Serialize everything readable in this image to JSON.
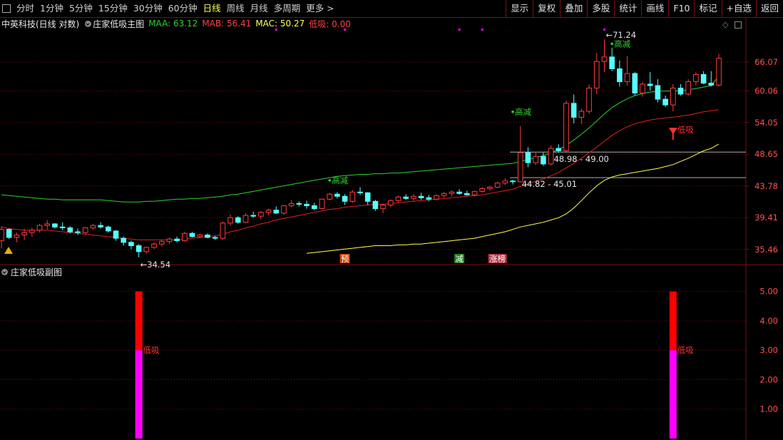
{
  "toolbar": {
    "periods": [
      "分时",
      "1分钟",
      "5分钟",
      "15分钟",
      "30分钟",
      "60分钟",
      "日线",
      "周线",
      "月线",
      "多周期",
      "更多 >"
    ],
    "active": "日线",
    "right_buttons": [
      "显示",
      "复权",
      "叠加",
      "多股",
      "统计",
      "画线",
      "F10",
      "标记",
      "+自选",
      "返回"
    ]
  },
  "info": {
    "stock": "中英科技(日线 对数)",
    "indicator": "庄家低吸主图",
    "maa": "MAA: 63.12",
    "mab": "MAB: 56.41",
    "mac": "MAC: 50.27",
    "dixi": "低吸: 0.00"
  },
  "sub": {
    "title": "庄家低吸副图"
  },
  "colors": {
    "up": "#ff3c3c",
    "down": "#54ffff",
    "maa": "#2fd12f",
    "mab": "#e02020",
    "mac": "#ffff55",
    "grid": "#7a1010",
    "axis_text": "#ff5050",
    "magenta": "#ff00ff"
  },
  "chart_data": [
    {
      "type": "candlestick",
      "title": "中英科技(日线 对数)",
      "log_scale": true,
      "ylim": [
        33.8,
        73.5
      ],
      "y_ticks": [
        66.07,
        60.06,
        54.05,
        48.65,
        43.78,
        39.41,
        35.46
      ],
      "y_tick_labels": [
        "66.07",
        "60.06",
        "54.05",
        "48.65",
        "43.78",
        "39.41",
        "35.46"
      ],
      "candles": [
        [
          36.5,
          38.3,
          35.6,
          37.9
        ],
        [
          37.9,
          38.0,
          36.7,
          36.9
        ],
        [
          36.9,
          37.5,
          36.3,
          37.2
        ],
        [
          37.2,
          38.0,
          36.6,
          37.5
        ],
        [
          37.5,
          38.1,
          37.0,
          37.8
        ],
        [
          37.8,
          38.6,
          37.5,
          38.4
        ],
        [
          38.4,
          39.1,
          37.9,
          38.6
        ],
        [
          38.6,
          38.7,
          38.0,
          38.2
        ],
        [
          38.2,
          38.8,
          37.8,
          38.1
        ],
        [
          38.1,
          38.3,
          37.4,
          37.6
        ],
        [
          37.6,
          38.0,
          37.2,
          37.5
        ],
        [
          37.5,
          38.2,
          37.3,
          38.1
        ],
        [
          38.1,
          38.6,
          37.9,
          38.4
        ],
        [
          38.4,
          38.8,
          38.0,
          38.2
        ],
        [
          38.2,
          38.4,
          37.5,
          37.7
        ],
        [
          37.7,
          37.8,
          36.5,
          36.8
        ],
        [
          36.8,
          37.0,
          35.9,
          36.3
        ],
        [
          36.3,
          36.5,
          35.5,
          35.9
        ],
        [
          35.9,
          36.1,
          34.54,
          35.2
        ],
        [
          35.2,
          35.8,
          35.0,
          35.7
        ],
        [
          35.7,
          36.3,
          35.5,
          36.1
        ],
        [
          36.1,
          36.6,
          35.8,
          36.4
        ],
        [
          36.4,
          36.9,
          36.1,
          36.7
        ],
        [
          36.7,
          37.0,
          36.3,
          36.5
        ],
        [
          36.5,
          37.6,
          36.4,
          37.4
        ],
        [
          37.4,
          37.6,
          36.9,
          37.0
        ],
        [
          37.0,
          37.4,
          36.8,
          37.2
        ],
        [
          37.2,
          37.4,
          36.8,
          36.9
        ],
        [
          36.9,
          37.1,
          36.6,
          36.8
        ],
        [
          36.8,
          38.9,
          36.6,
          38.7
        ],
        [
          38.7,
          39.8,
          38.4,
          39.4
        ],
        [
          39.4,
          39.6,
          38.6,
          38.8
        ],
        [
          38.8,
          40.0,
          38.7,
          39.7
        ],
        [
          39.7,
          40.2,
          39.4,
          39.6
        ],
        [
          39.6,
          40.3,
          39.2,
          40.1
        ],
        [
          40.1,
          40.6,
          39.7,
          40.4
        ],
        [
          40.4,
          40.9,
          39.9,
          40.0
        ],
        [
          40.0,
          41.1,
          39.8,
          41.0
        ],
        [
          41.0,
          41.8,
          40.8,
          41.3
        ],
        [
          41.3,
          41.6,
          40.9,
          41.2
        ],
        [
          41.2,
          41.7,
          40.6,
          41.0
        ],
        [
          41.0,
          41.4,
          40.4,
          40.6
        ],
        [
          40.6,
          42.0,
          40.5,
          41.9
        ],
        [
          41.9,
          42.8,
          41.7,
          42.6
        ],
        [
          42.6,
          42.9,
          42.0,
          42.3
        ],
        [
          42.3,
          42.6,
          41.1,
          41.6
        ],
        [
          41.6,
          43.2,
          41.4,
          42.9
        ],
        [
          42.9,
          43.6,
          42.5,
          42.8
        ],
        [
          42.8,
          42.9,
          41.1,
          41.6
        ],
        [
          41.6,
          41.8,
          40.3,
          40.6
        ],
        [
          40.6,
          41.3,
          40.0,
          41.1
        ],
        [
          41.1,
          41.9,
          40.8,
          41.7
        ],
        [
          41.7,
          42.4,
          41.4,
          42.2
        ],
        [
          42.2,
          42.6,
          41.8,
          42.0
        ],
        [
          42.0,
          42.6,
          41.7,
          42.3
        ],
        [
          42.3,
          42.8,
          41.8,
          42.1
        ],
        [
          42.1,
          42.5,
          41.6,
          41.9
        ],
        [
          41.9,
          42.6,
          41.7,
          42.4
        ],
        [
          42.4,
          42.9,
          42.1,
          42.7
        ],
        [
          42.7,
          43.1,
          42.3,
          42.9
        ],
        [
          42.9,
          43.3,
          42.5,
          42.7
        ],
        [
          42.7,
          43.1,
          42.4,
          42.5
        ],
        [
          42.5,
          43.1,
          42.3,
          43.0
        ],
        [
          43.0,
          43.6,
          42.8,
          43.4
        ],
        [
          43.4,
          43.8,
          43.1,
          43.6
        ],
        [
          43.6,
          44.4,
          43.5,
          44.2
        ],
        [
          44.2,
          44.9,
          43.9,
          44.5
        ],
        [
          44.5,
          44.7,
          44.0,
          44.4
        ],
        [
          44.4,
          53.4,
          44.3,
          48.9
        ],
        [
          48.9,
          49.8,
          46.6,
          47.3
        ],
        [
          47.3,
          48.9,
          46.9,
          48.3
        ],
        [
          48.3,
          48.9,
          46.8,
          47.1
        ],
        [
          47.1,
          50.1,
          46.9,
          49.6
        ],
        [
          49.6,
          50.3,
          48.9,
          49.2
        ],
        [
          49.2,
          58.1,
          49.1,
          57.6
        ],
        [
          57.6,
          59.3,
          53.9,
          55.0
        ],
        [
          55.0,
          56.6,
          53.8,
          56.1
        ],
        [
          56.1,
          61.3,
          55.7,
          60.6
        ],
        [
          60.6,
          68.1,
          59.4,
          66.2
        ],
        [
          66.2,
          71.24,
          63.9,
          67.2
        ],
        [
          67.2,
          69.3,
          64.1,
          64.6
        ],
        [
          64.6,
          66.4,
          60.9,
          61.9
        ],
        [
          61.9,
          67.4,
          61.1,
          63.6
        ],
        [
          63.6,
          63.9,
          59.1,
          59.6
        ],
        [
          59.6,
          61.9,
          58.9,
          61.4
        ],
        [
          61.4,
          63.9,
          60.1,
          61.1
        ],
        [
          61.1,
          62.4,
          57.8,
          58.4
        ],
        [
          58.4,
          59.1,
          56.9,
          57.3
        ],
        [
          57.3,
          61.4,
          56.1,
          60.6
        ],
        [
          60.6,
          61.4,
          59.1,
          59.4
        ],
        [
          59.4,
          62.4,
          59.1,
          61.9
        ],
        [
          61.9,
          63.9,
          61.1,
          63.4
        ],
        [
          63.4,
          64.1,
          61.4,
          61.6
        ],
        [
          61.6,
          64.1,
          60.9,
          61.2
        ],
        [
          61.2,
          67.9,
          60.9,
          66.9
        ]
      ],
      "series": [
        {
          "name": "MAA",
          "values": [
            42.5,
            42.4,
            42.3,
            42.2,
            42.1,
            42.0,
            41.9,
            41.9,
            41.8,
            41.8,
            41.8,
            41.8,
            41.8,
            41.8,
            41.7,
            41.6,
            41.5,
            41.5,
            41.5,
            41.6,
            41.6,
            41.7,
            41.8,
            41.9,
            41.9,
            42.0,
            42.0,
            42.1,
            42.2,
            42.3,
            42.5,
            42.6,
            42.8,
            43.0,
            43.2,
            43.4,
            43.6,
            43.8,
            44.0,
            44.2,
            44.4,
            44.6,
            44.8,
            45.0,
            45.2,
            45.3,
            45.4,
            45.5,
            45.5,
            45.6,
            45.6,
            45.7,
            45.7,
            45.8,
            45.9,
            46.0,
            46.1,
            46.2,
            46.3,
            46.4,
            46.5,
            46.6,
            46.7,
            46.8,
            46.9,
            47.0,
            47.1,
            47.2,
            47.5,
            47.8,
            48.1,
            48.4,
            48.9,
            49.4,
            50.1,
            51.0,
            52.0,
            53.1,
            54.3,
            55.6,
            56.8,
            57.7,
            58.5,
            59.1,
            59.5,
            59.8,
            60.0,
            60.0,
            60.0,
            60.1,
            60.3,
            60.5,
            60.8,
            61.1,
            63.1
          ]
        },
        {
          "name": "MAB",
          "values": [
            38.2,
            38.0,
            37.9,
            37.8,
            37.8,
            37.8,
            37.8,
            37.7,
            37.6,
            37.5,
            37.4,
            37.3,
            37.2,
            37.1,
            37.0,
            36.9,
            36.8,
            36.7,
            36.6,
            36.6,
            36.6,
            36.6,
            36.6,
            36.6,
            36.7,
            36.8,
            36.9,
            37.0,
            37.1,
            37.3,
            37.6,
            37.8,
            38.1,
            38.3,
            38.6,
            38.8,
            39.1,
            39.3,
            39.5,
            39.7,
            39.9,
            40.1,
            40.3,
            40.5,
            40.6,
            40.8,
            40.9,
            41.0,
            41.1,
            41.2,
            41.2,
            41.3,
            41.4,
            41.5,
            41.6,
            41.7,
            41.8,
            41.9,
            42.0,
            42.1,
            42.2,
            42.3,
            42.4,
            42.5,
            42.7,
            42.9,
            43.1,
            43.3,
            43.7,
            44.1,
            44.5,
            44.8,
            45.3,
            45.8,
            46.5,
            47.2,
            48.0,
            48.9,
            49.8,
            50.8,
            51.8,
            52.6,
            53.3,
            53.8,
            54.2,
            54.5,
            54.7,
            54.9,
            55.0,
            55.2,
            55.4,
            55.7,
            56.0,
            56.2,
            56.4
          ]
        },
        {
          "name": "MAC",
          "values": [
            null,
            null,
            null,
            null,
            null,
            null,
            null,
            null,
            null,
            null,
            null,
            null,
            null,
            null,
            null,
            null,
            null,
            null,
            null,
            null,
            null,
            null,
            null,
            null,
            null,
            null,
            null,
            null,
            null,
            null,
            null,
            null,
            null,
            null,
            null,
            null,
            null,
            null,
            null,
            null,
            35.0,
            35.1,
            35.2,
            35.3,
            35.4,
            35.5,
            35.6,
            35.7,
            35.8,
            35.9,
            35.9,
            35.9,
            36.0,
            36.0,
            36.1,
            36.1,
            36.2,
            36.3,
            36.4,
            36.5,
            36.6,
            36.7,
            36.8,
            37.0,
            37.2,
            37.4,
            37.6,
            37.9,
            38.2,
            38.4,
            38.6,
            38.8,
            39.1,
            39.4,
            39.9,
            40.7,
            41.7,
            42.8,
            43.8,
            44.6,
            45.1,
            45.4,
            45.6,
            45.8,
            46.0,
            46.2,
            46.4,
            46.7,
            47.0,
            47.5,
            48.0,
            48.6,
            49.2,
            49.6,
            50.3
          ]
        }
      ],
      "hlines": [
        {
          "value": 49.0,
          "label": "48.98 - 49.00"
        },
        {
          "value": 45.0,
          "label": "44.82 - 45.01"
        }
      ],
      "annotations": [
        {
          "text": "34.54",
          "idx": 18,
          "value": 34.54
        },
        {
          "text": "71.24",
          "idx": 79,
          "value": 71.24
        },
        {
          "text": "高减",
          "idx": 43,
          "value": 44.6
        },
        {
          "text": "高减",
          "idx": 67,
          "value": 56.0
        },
        {
          "text": "高减",
          "idx": 80,
          "value": 70.2
        },
        {
          "text": "低吸",
          "idx": 88,
          "value": 52.5
        }
      ],
      "markers": [
        {
          "text": "预",
          "idx": 45
        },
        {
          "text": "减",
          "idx": 60
        },
        {
          "text": "涨榜",
          "idx": 65
        }
      ]
    },
    {
      "type": "bar",
      "title": "庄家低吸副图",
      "ylim": [
        0,
        5.5
      ],
      "y_ticks": [
        5.0,
        4.0,
        3.0,
        2.0,
        1.0
      ],
      "y_tick_labels": [
        "5.00",
        "4.00",
        "3.00",
        "2.00",
        "1.00"
      ],
      "bars": [
        {
          "idx": 18,
          "value": 5,
          "split": 3,
          "label": "低吸"
        },
        {
          "idx": 88,
          "value": 5,
          "split": 3,
          "label": "低吸"
        }
      ]
    }
  ]
}
